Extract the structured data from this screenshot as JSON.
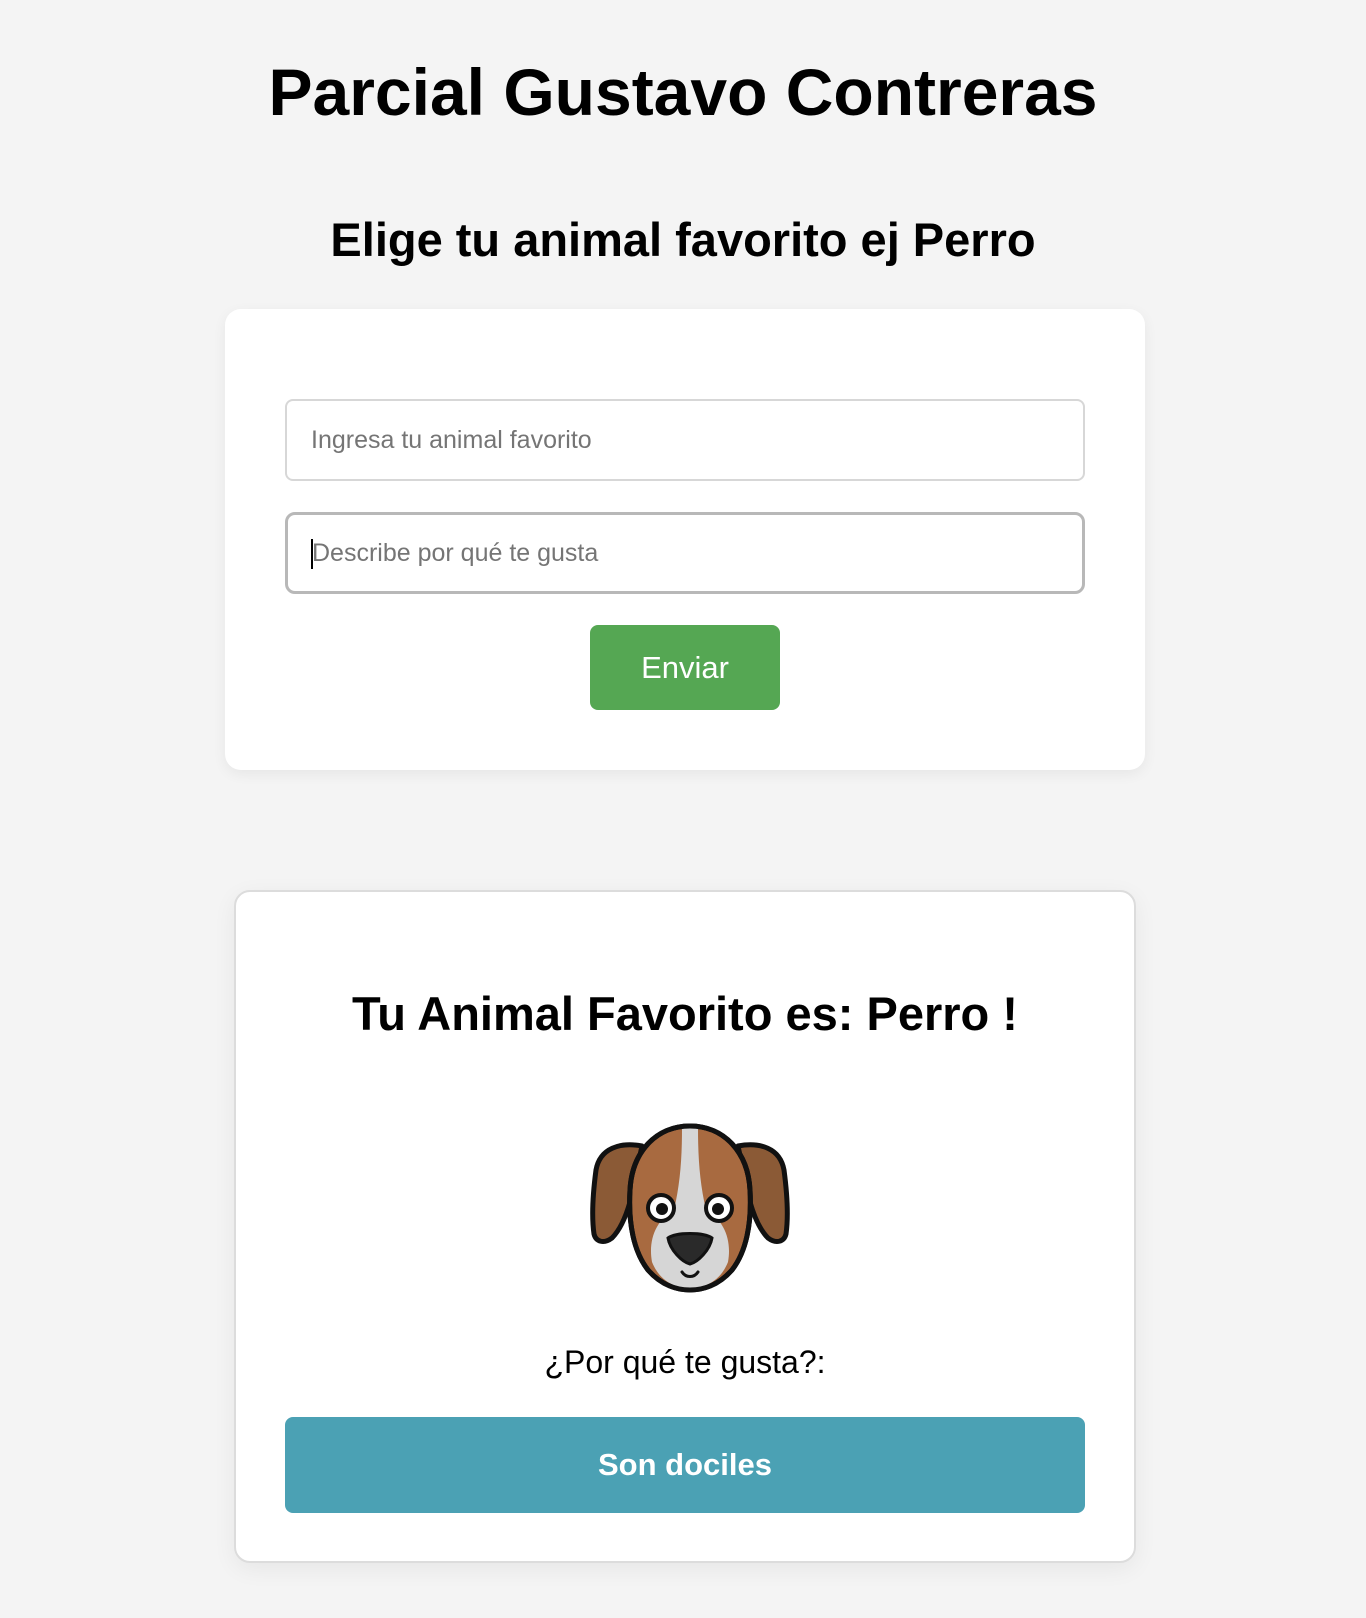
{
  "header": {
    "title": "Parcial Gustavo Contreras",
    "subtitle": "Elige tu animal favorito ej Perro"
  },
  "form": {
    "animal_placeholder": "Ingresa tu animal favorito",
    "reason_placeholder": "Describe por qué te gusta",
    "submit_label": "Enviar"
  },
  "result": {
    "title": "Tu Animal Favorito es: Perro !",
    "animal_icon": "dog-face-icon",
    "why_label": "¿Por qué te gusta?:",
    "reason_text": "Son dociles"
  },
  "colors": {
    "background": "#f4f4f4",
    "submit_button": "#55a753",
    "reason_banner": "#4ba1b4"
  }
}
